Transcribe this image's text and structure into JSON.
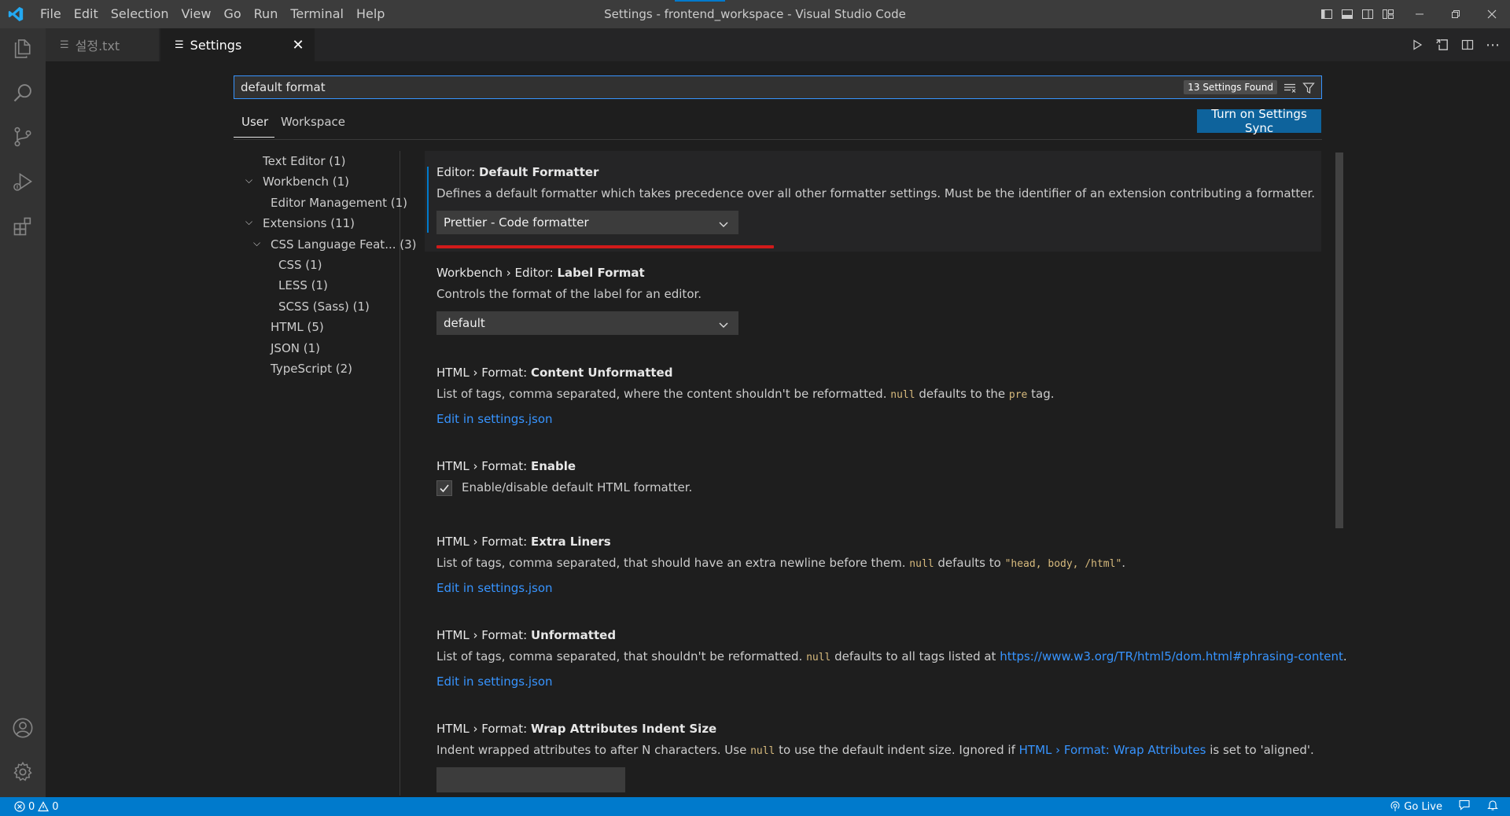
{
  "window": {
    "title": "Settings - frontend_workspace - Visual Studio Code"
  },
  "menu": [
    "File",
    "Edit",
    "Selection",
    "View",
    "Go",
    "Run",
    "Terminal",
    "Help"
  ],
  "tabs": [
    {
      "label": "설정.txt",
      "active": false
    },
    {
      "label": "Settings",
      "active": true
    }
  ],
  "search": {
    "value": "default format",
    "results_badge": "13 Settings Found"
  },
  "scope": {
    "user": "User",
    "workspace": "Workspace",
    "sync_button": "Turn on Settings Sync"
  },
  "toc": [
    {
      "label": "Text Editor (1)"
    },
    {
      "label": "Workbench (1)"
    },
    {
      "label": "Editor Management (1)"
    },
    {
      "label": "Extensions (11)"
    },
    {
      "label": "CSS Language Feat... (3)"
    },
    {
      "label": "CSS (1)"
    },
    {
      "label": "LESS (1)"
    },
    {
      "label": "SCSS (Sass) (1)"
    },
    {
      "label": "HTML (5)"
    },
    {
      "label": "JSON (1)"
    },
    {
      "label": "TypeScript (2)"
    }
  ],
  "settings": {
    "s1": {
      "prefix": "Editor: ",
      "name": "Default Formatter",
      "desc": "Defines a default formatter which takes precedence over all other formatter settings. Must be the identifier of an extension contributing a formatter.",
      "value": "Prettier - Code formatter"
    },
    "s2": {
      "prefix": "Workbench › Editor: ",
      "name": "Label Format",
      "desc": "Controls the format of the label for an editor.",
      "value": "default"
    },
    "s3": {
      "prefix": "HTML › Format: ",
      "name": "Content Unformatted",
      "desc_a": "List of tags, comma separated, where the content shouldn't be reformatted. ",
      "code_a": "null",
      "desc_b": " defaults to the ",
      "code_b": "pre",
      "desc_c": " tag.",
      "edit_link": "Edit in settings.json"
    },
    "s4": {
      "prefix": "HTML › Format: ",
      "name": "Enable",
      "checkbox_label": "Enable/disable default HTML formatter.",
      "checked": true
    },
    "s5": {
      "prefix": "HTML › Format: ",
      "name": "Extra Liners",
      "desc_a": "List of tags, comma separated, that should have an extra newline before them. ",
      "code_a": "null",
      "desc_b": " defaults to ",
      "code_b": "\"head, body, /html\"",
      "desc_c": ".",
      "edit_link": "Edit in settings.json"
    },
    "s6": {
      "prefix": "HTML › Format: ",
      "name": "Unformatted",
      "desc_a": "List of tags, comma separated, that shouldn't be reformatted. ",
      "code_a": "null",
      "desc_b": " defaults to all tags listed at ",
      "link": "https://www.w3.org/TR/html5/dom.html#phrasing-content",
      "desc_c": ".",
      "edit_link": "Edit in settings.json"
    },
    "s7": {
      "prefix": "HTML › Format: ",
      "name": "Wrap Attributes Indent Size",
      "desc_a": "Indent wrapped attributes to after N characters. Use ",
      "code_a": "null",
      "desc_b": " to use the default indent size. Ignored if ",
      "link": "HTML › Format: Wrap Attributes",
      "desc_c": " is set to 'aligned'.",
      "value": ""
    }
  },
  "statusbar": {
    "errors": "0",
    "warnings": "0",
    "go_live": "Go Live"
  },
  "colors": {
    "accent": "#007acc",
    "highlight": "#d11a1a",
    "link": "#3794ff"
  }
}
